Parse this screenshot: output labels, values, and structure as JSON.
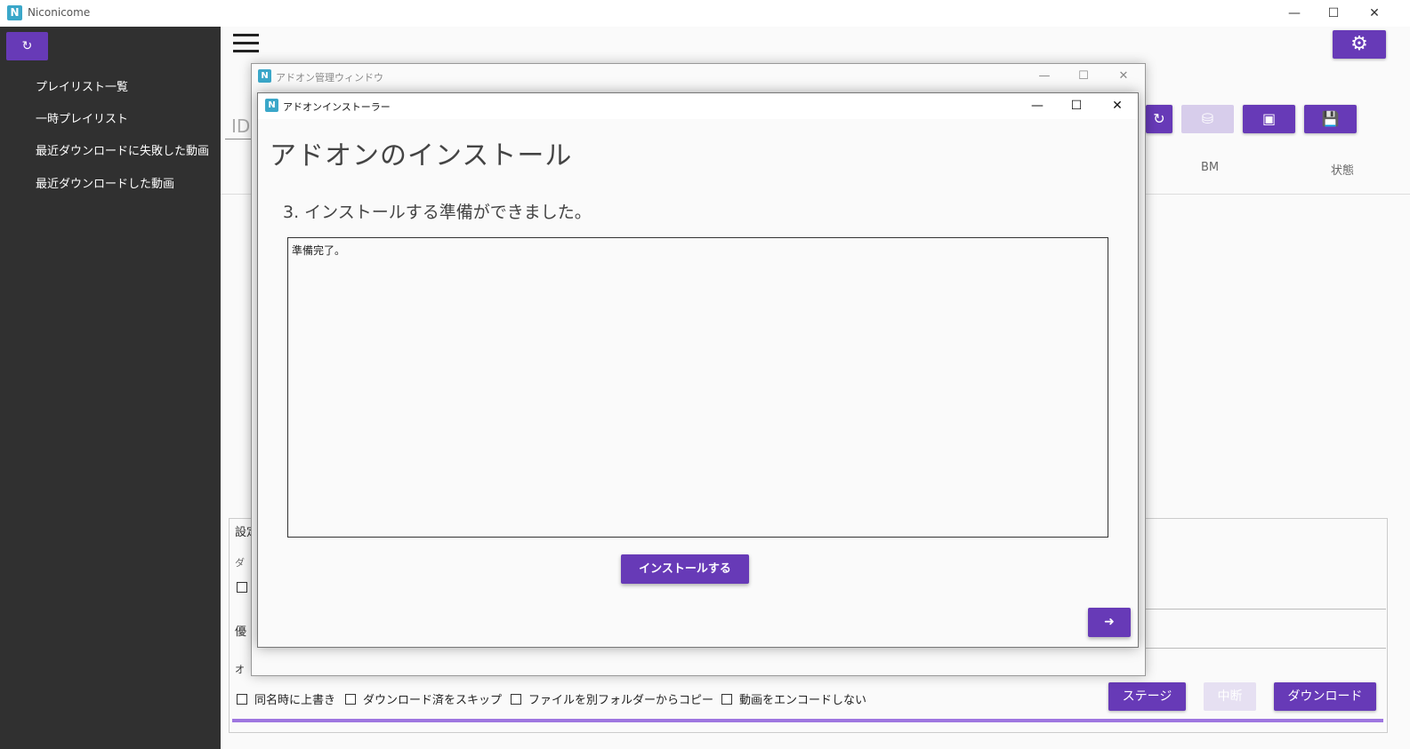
{
  "main_window": {
    "title": "Niconicome",
    "logo_letter": "N",
    "controls": {
      "minimize": "—",
      "maximize": "☐",
      "close": "✕"
    }
  },
  "sidebar": {
    "refresh_icon": "refresh-icon",
    "items": [
      {
        "label": "プレイリスト一覧"
      },
      {
        "label": "一時プレイリスト"
      },
      {
        "label": "最近ダウンロードに失敗した動画"
      },
      {
        "label": "最近ダウンロードした動画"
      }
    ]
  },
  "main": {
    "id_placeholder": "ID",
    "columns": {
      "bm": "BM",
      "status": "状態"
    },
    "settings": {
      "section_title": "設定",
      "download_label": "ダ",
      "priority_label": "優",
      "option_label": "オ",
      "options": [
        {
          "label": "同名時に上書き",
          "checked": false
        },
        {
          "label": "ダウンロード済をスキップ",
          "checked": false
        },
        {
          "label": "ファイルを別フォルダーからコピー",
          "checked": false
        },
        {
          "label": "動画をエンコードしない",
          "checked": false
        }
      ],
      "buttons": {
        "stage": "ステージ",
        "abort": "中断",
        "download": "ダウンロード"
      }
    }
  },
  "addon_manager": {
    "title": "アドオン管理ウィンドウ",
    "logo_letter": "N",
    "controls": {
      "minimize": "—",
      "maximize": "☐",
      "close": "✕"
    }
  },
  "installer": {
    "title": "アドオンインストーラー",
    "logo_letter": "N",
    "controls": {
      "minimize": "—",
      "maximize": "☐",
      "close": "✕"
    },
    "heading": "アドオンのインストール",
    "step": "3. インストールする準備ができました。",
    "log": "準備完了。",
    "install_button": "インストールする",
    "next_icon": "arrow-right-circle-icon"
  },
  "colors": {
    "accent": "#673ab7",
    "sidebar": "#303030",
    "accent_disabled": "#d7cdeb"
  }
}
